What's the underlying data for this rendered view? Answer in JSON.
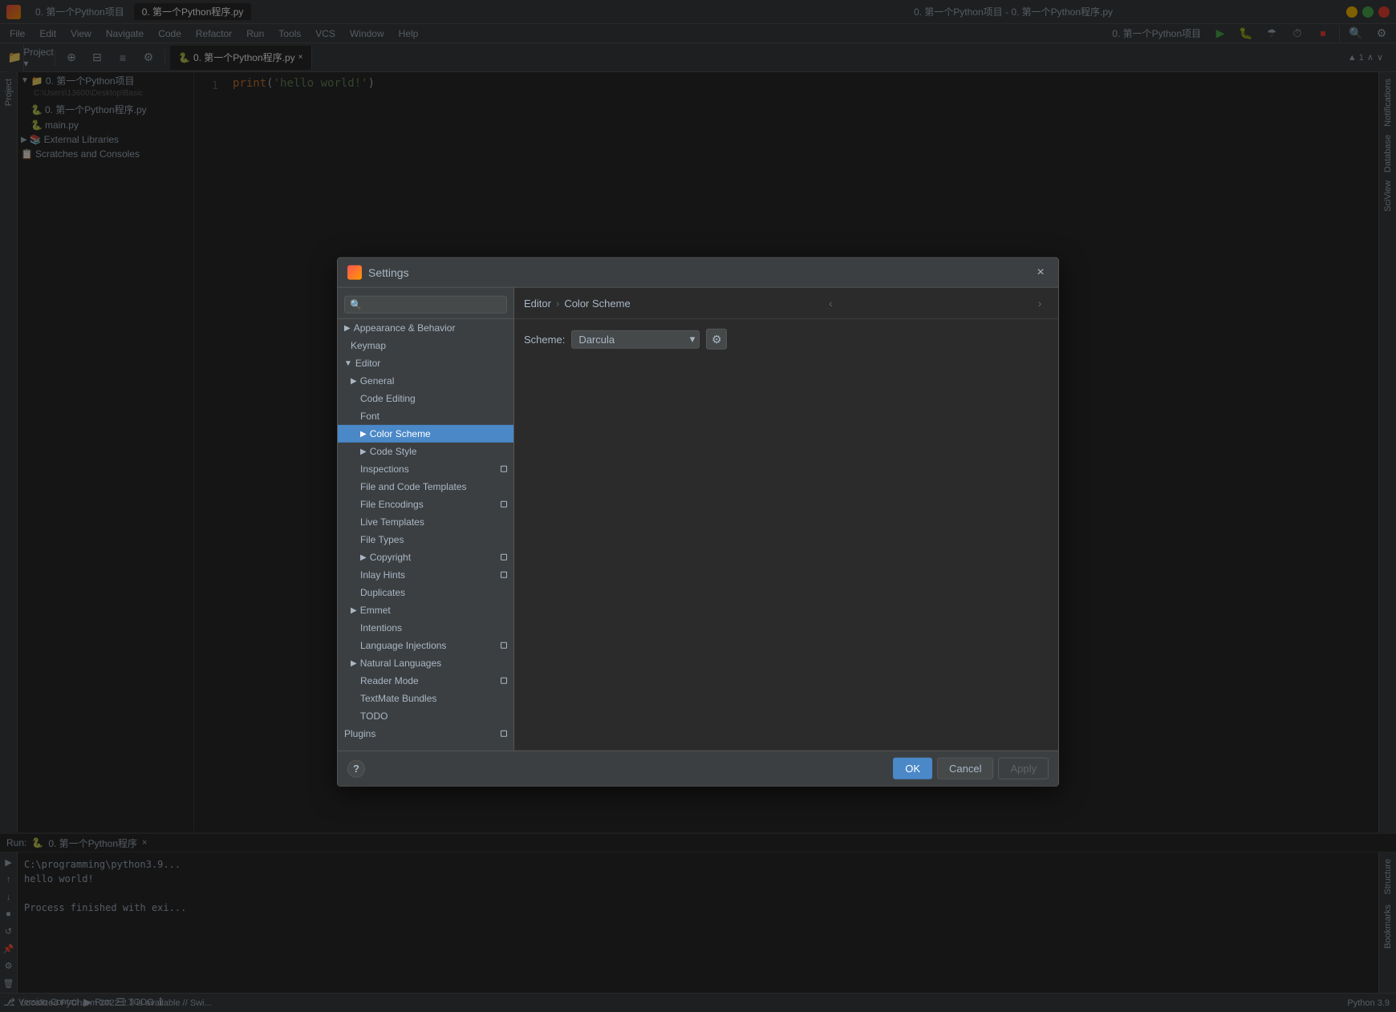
{
  "window": {
    "title": "0. 第一个Python项目 - 0. 第一个Python程序.py",
    "logo": "pycharm"
  },
  "menubar": {
    "items": [
      "File",
      "Edit",
      "View",
      "Navigate",
      "Code",
      "Refactor",
      "Run",
      "Tools",
      "VCS",
      "Window",
      "Help"
    ]
  },
  "tabs": {
    "project_tab": "0. 第一个Python项目",
    "file_tab": "0. 第一个Python程序.py",
    "active_tab": "0. 第一个Python程序.py"
  },
  "project_tree": {
    "root": "0. 第一个Python项目",
    "root_path": "C:\\Users\\13600\\Desktop\\Basic",
    "items": [
      {
        "label": "0. 第一个Python程序.py",
        "type": "file",
        "indent": 1
      },
      {
        "label": "main.py",
        "type": "file",
        "indent": 1
      },
      {
        "label": "External Libraries",
        "type": "folder",
        "indent": 0
      },
      {
        "label": "Scratches and Consoles",
        "type": "folder",
        "indent": 0
      }
    ]
  },
  "editor": {
    "line_number": "1",
    "code": "print('hello world!')"
  },
  "run_bar": {
    "label": "Run:",
    "name": "0. 第一个Python程序",
    "close": "×"
  },
  "bottom_output": {
    "line1": "C:\\programming\\python3.9...",
    "line2": "hello world!",
    "line3": "",
    "line4": "Process finished with exi..."
  },
  "status_bar": {
    "message": "Localized PyCharm 2022.2.3 is available // Swi...",
    "python_version": "Python 3.9"
  },
  "settings_dialog": {
    "title": "Settings",
    "search_placeholder": "🔍",
    "nav_items": [
      {
        "id": "appearance",
        "label": "Appearance & Behavior",
        "indent": 0,
        "hasArrow": true,
        "collapsed": true
      },
      {
        "id": "keymap",
        "label": "Keymap",
        "indent": 1,
        "hasArrow": false
      },
      {
        "id": "editor",
        "label": "Editor",
        "indent": 0,
        "hasArrow": true,
        "expanded": true
      },
      {
        "id": "general",
        "label": "General",
        "indent": 1,
        "hasArrow": true
      },
      {
        "id": "code-editing",
        "label": "Code Editing",
        "indent": 2,
        "hasArrow": false
      },
      {
        "id": "font",
        "label": "Font",
        "indent": 2,
        "hasArrow": false
      },
      {
        "id": "color-scheme",
        "label": "Color Scheme",
        "indent": 2,
        "hasArrow": true,
        "selected": true
      },
      {
        "id": "code-style",
        "label": "Code Style",
        "indent": 2,
        "hasArrow": true
      },
      {
        "id": "inspections",
        "label": "Inspections",
        "indent": 2,
        "hasArrow": false,
        "hasIndicator": true
      },
      {
        "id": "file-and-code-templates",
        "label": "File and Code Templates",
        "indent": 2,
        "hasArrow": false
      },
      {
        "id": "file-encodings",
        "label": "File Encodings",
        "indent": 2,
        "hasArrow": false,
        "hasIndicator": true
      },
      {
        "id": "live-templates",
        "label": "Live Templates",
        "indent": 2,
        "hasArrow": false
      },
      {
        "id": "file-types",
        "label": "File Types",
        "indent": 2,
        "hasArrow": false
      },
      {
        "id": "copyright",
        "label": "Copyright",
        "indent": 2,
        "hasArrow": true,
        "hasIndicator": true
      },
      {
        "id": "inlay-hints",
        "label": "Inlay Hints",
        "indent": 2,
        "hasArrow": false,
        "hasIndicator": true
      },
      {
        "id": "duplicates",
        "label": "Duplicates",
        "indent": 2,
        "hasArrow": false
      },
      {
        "id": "emmet",
        "label": "Emmet",
        "indent": 1,
        "hasArrow": true
      },
      {
        "id": "intentions",
        "label": "Intentions",
        "indent": 2,
        "hasArrow": false
      },
      {
        "id": "language-injections",
        "label": "Language Injections",
        "indent": 2,
        "hasArrow": false,
        "hasIndicator": true
      },
      {
        "id": "natural-languages",
        "label": "Natural Languages",
        "indent": 1,
        "hasArrow": true
      },
      {
        "id": "reader-mode",
        "label": "Reader Mode",
        "indent": 2,
        "hasArrow": false,
        "hasIndicator": true
      },
      {
        "id": "textmate-bundles",
        "label": "TextMate Bundles",
        "indent": 2,
        "hasArrow": false
      },
      {
        "id": "todo",
        "label": "TODO",
        "indent": 2,
        "hasArrow": false
      },
      {
        "id": "plugins",
        "label": "Plugins",
        "indent": 0,
        "hasArrow": false,
        "hasIndicator": true
      }
    ],
    "breadcrumb": {
      "parent": "Editor",
      "current": "Color Scheme"
    },
    "content": {
      "scheme_label": "Scheme:",
      "scheme_value": "Darcula"
    },
    "footer": {
      "ok_label": "OK",
      "cancel_label": "Cancel",
      "apply_label": "Apply",
      "help_label": "?"
    }
  }
}
